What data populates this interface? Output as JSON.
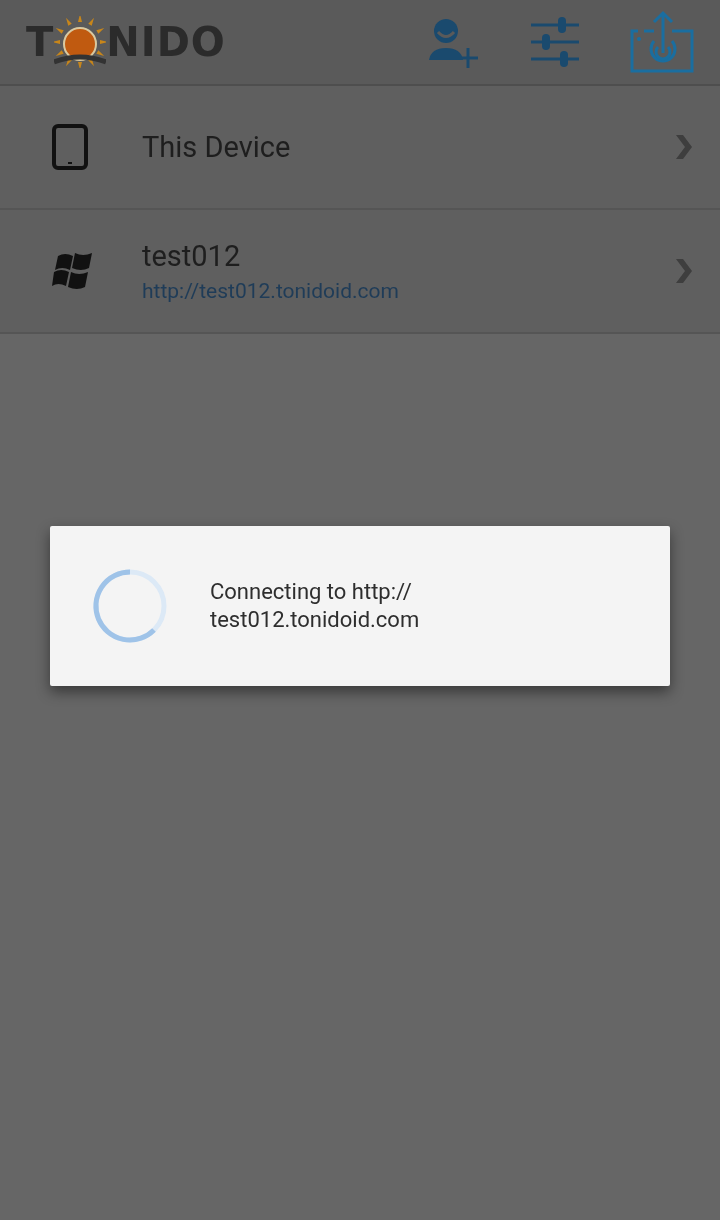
{
  "header": {
    "logo": {
      "before": "T",
      "after": "NIDO"
    },
    "actions": [
      {
        "kind": "add-user"
      },
      {
        "kind": "settings"
      },
      {
        "kind": "share"
      }
    ]
  },
  "devices": [
    {
      "kind": "tablet",
      "name": "This Device"
    },
    {
      "kind": "windows",
      "name": "test012",
      "url": "http://test012.tonidoid.com"
    }
  ],
  "dialog": {
    "message_lines": [
      "Connecting to http://",
      "test012.tonidoid.com"
    ]
  }
}
